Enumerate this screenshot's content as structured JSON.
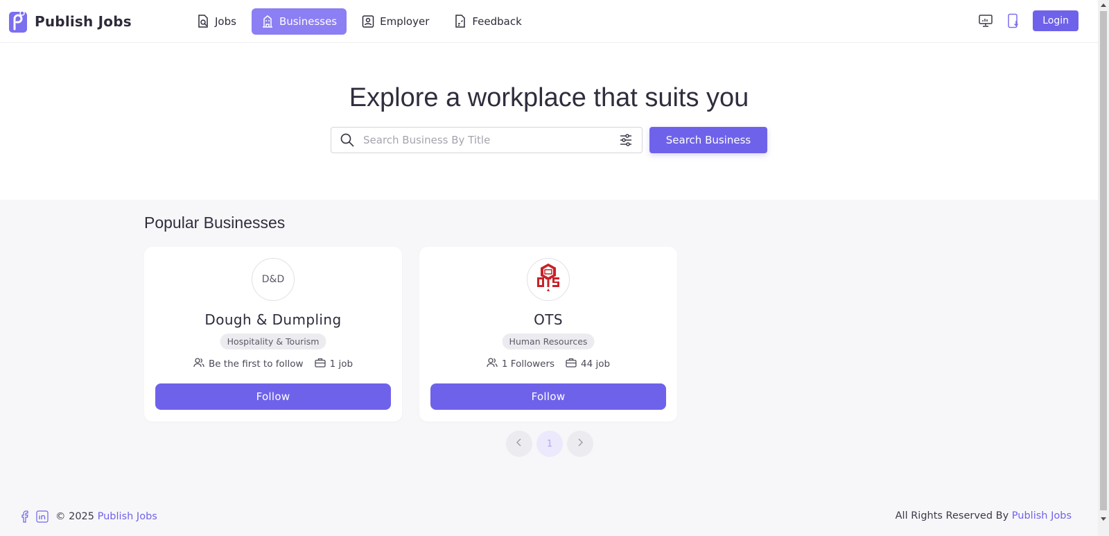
{
  "app": {
    "name": "Publish Jobs"
  },
  "nav": [
    {
      "label": "Jobs",
      "icon": "document-search-icon",
      "active": false
    },
    {
      "label": "Businesses",
      "icon": "building-icon",
      "active": true
    },
    {
      "label": "Employer",
      "icon": "user-badge-icon",
      "active": false
    },
    {
      "label": "Feedback",
      "icon": "feedback-document-icon",
      "active": false
    }
  ],
  "header": {
    "login_label": "Login",
    "icons": [
      "monitor-icon",
      "mobile-download-icon"
    ]
  },
  "hero": {
    "title": "Explore a workplace that suits you",
    "search_placeholder": "Search Business By Title",
    "search_value": "",
    "search_button": "Search Business"
  },
  "popular": {
    "title": "Popular Businesses",
    "cards": [
      {
        "avatar_text": "D&D",
        "name": "Dough & Dumpling",
        "category": "Hospitality & Tourism",
        "followers": "Be the first to follow",
        "jobs": "1 job",
        "follow_label": "Follow"
      },
      {
        "avatar_text": "",
        "logo": "ots-logo",
        "name": "OTS",
        "category": "Human Resources",
        "followers": "1 Followers",
        "jobs": "44 job",
        "follow_label": "Follow"
      }
    ]
  },
  "pagination": {
    "current": "1"
  },
  "footer": {
    "copyright_prefix": "© 2025",
    "copyright_link": "Publish Jobs",
    "rights_prefix": "All Rights Reserved By",
    "rights_link": "Publish Jobs"
  },
  "colors": {
    "accent": "#6f62ea",
    "active_nav": "#8c7ef3",
    "content_bg": "#f7f7f9"
  }
}
